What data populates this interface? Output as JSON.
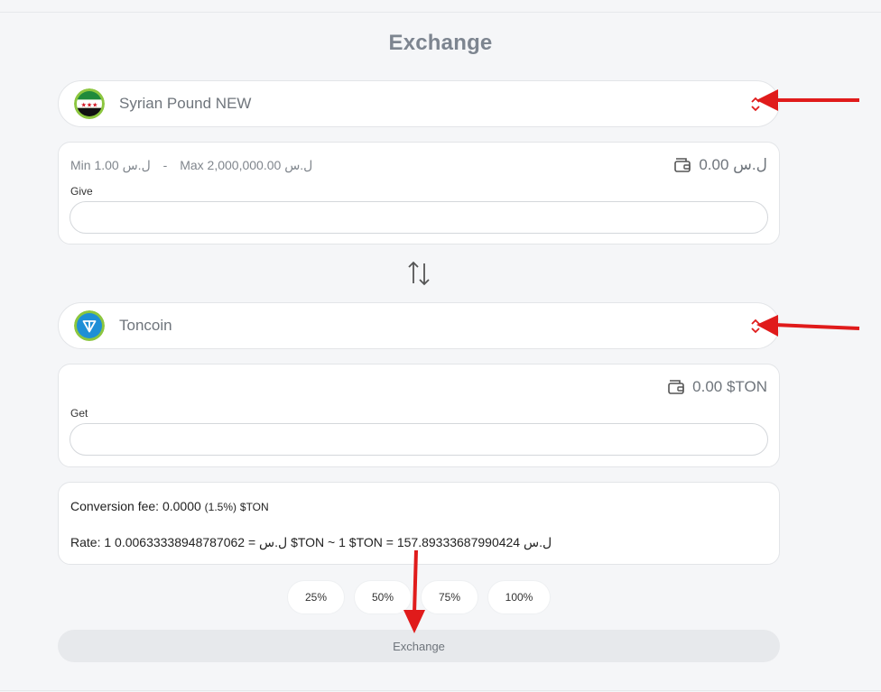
{
  "page": {
    "title": "Exchange"
  },
  "give": {
    "currency": "Syrian Pound NEW",
    "min_text": "Min 1.00 ل.س",
    "separator": "-",
    "max_text": "Max 2,000,000.00 ل.س",
    "balance": "ل.س 0.00",
    "label": "Give",
    "value": "",
    "placeholder": ""
  },
  "get": {
    "currency": "Toncoin",
    "balance": "0.00 $TON",
    "label": "Get",
    "value": "",
    "placeholder": ""
  },
  "info": {
    "fee_label": "Conversion fee: 0.0000",
    "fee_percent": "(1.5%)",
    "fee_unit": "$TON",
    "rate_text": "Rate: 1 ل.س = 0.00633338948787062 $TON ~ 1 $TON = 157.89333687990424 ل.س"
  },
  "percent_buttons": [
    "25%",
    "50%",
    "75%",
    "100%"
  ],
  "exchange_button": "Exchange",
  "colors": {
    "annotation_arrow": "#e01b1b",
    "chevron": "#e01b1b",
    "ton_blue": "#1e8fd6",
    "ton_ring": "#8cc63f"
  },
  "icons": [
    "syria-flag-icon",
    "toncoin-icon",
    "chevron-up-down-icon",
    "wallet-icon",
    "swap-arrows-icon"
  ]
}
